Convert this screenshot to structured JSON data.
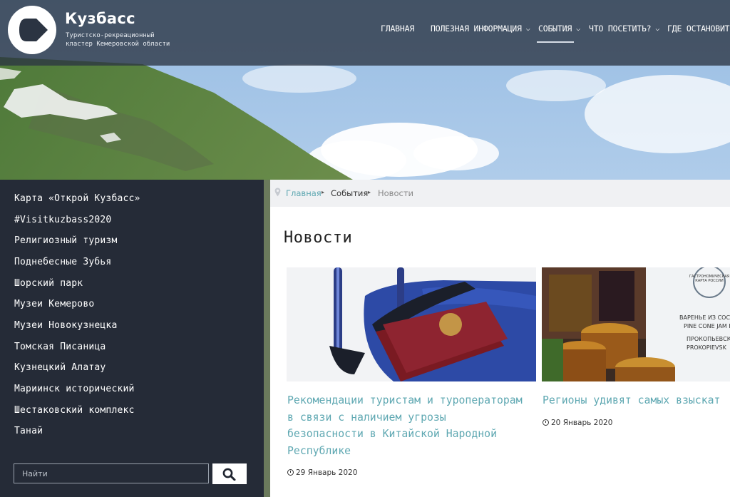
{
  "header": {
    "brand": "Кузбасс",
    "tagline_line1": "Туристско-рекреационный",
    "tagline_line2": "кластер Кемеровской области",
    "nav": [
      {
        "label": "ГЛАВНАЯ",
        "has_dropdown": false
      },
      {
        "label": "ПОЛЕЗНАЯ ИНФОРМАЦИЯ",
        "has_dropdown": true
      },
      {
        "label": "СОБЫТИЯ",
        "has_dropdown": true,
        "active": true
      },
      {
        "label": "ЧТО ПОСЕТИТЬ?",
        "has_dropdown": true
      },
      {
        "label": "ГДЕ ОСТАНОВИТЬ",
        "has_dropdown": false
      }
    ],
    "chevron_glyph": "⌵"
  },
  "sidebar": {
    "items": [
      "Карта «Открой Кузбасс»",
      "#Visitkuzbass2020",
      "Религиозный туризм",
      "Поднебесные Зубья",
      "Шорский парк",
      "Музеи Кемерово",
      "Музеи Новокузнецка",
      "Томская Писаница",
      "Кузнецкий Алатау",
      "Мариинск исторический",
      "Шестаковский комплекс",
      "Танай"
    ],
    "search_placeholder": "Найти",
    "search_icon": "search-icon"
  },
  "breadcrumb": {
    "items": [
      "Главная",
      "События",
      "Новости"
    ],
    "separator": "▸",
    "icon": "map-pin-icon"
  },
  "page_title": "Новости",
  "news": [
    {
      "title_lines": [
        "Рекомендации туристам и туроператорам",
        "в связи с наличием угрозы",
        "безопасности в Китайской Народной",
        "Республике"
      ],
      "date": "29 Январь 2020",
      "image": "suitcase-passport-photo"
    },
    {
      "title_lines": [
        "Регионы удивят самых взыскат"
      ],
      "date": "20 Январь 2020",
      "image": "pine-cone-jam-photo",
      "image_text": [
        "ГАСТРОНОМИЧЕСКАЯ КАРТА РОССИИ",
        "ВАРЕНЬЕ ИЗ СОСНОВЫ",
        "PINE CONE JAM FROM",
        "ПРОКОПЬЕВСКИЙ",
        "PROKOPIEVSK"
      ]
    }
  ],
  "colors": {
    "header_bg": "#2b3442",
    "sidebar_bg": "#252b37",
    "link_teal": "#5fa8b2",
    "breadcrumb_bg": "#f0f1f3"
  }
}
